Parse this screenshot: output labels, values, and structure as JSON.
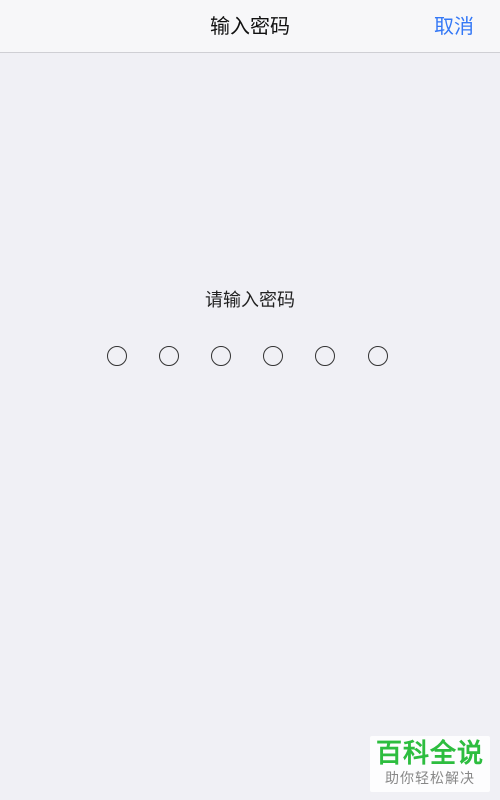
{
  "navbar": {
    "title": "输入密码",
    "cancel_label": "取消"
  },
  "prompt": "请输入密码",
  "pin": {
    "length": 6,
    "entered": 0
  },
  "watermark": {
    "title": "百科全说",
    "subtitle": "助你轻松解决"
  },
  "colors": {
    "accent": "#3478f6",
    "background": "#f0f0f5",
    "watermark_green": "#2dbd3f"
  }
}
